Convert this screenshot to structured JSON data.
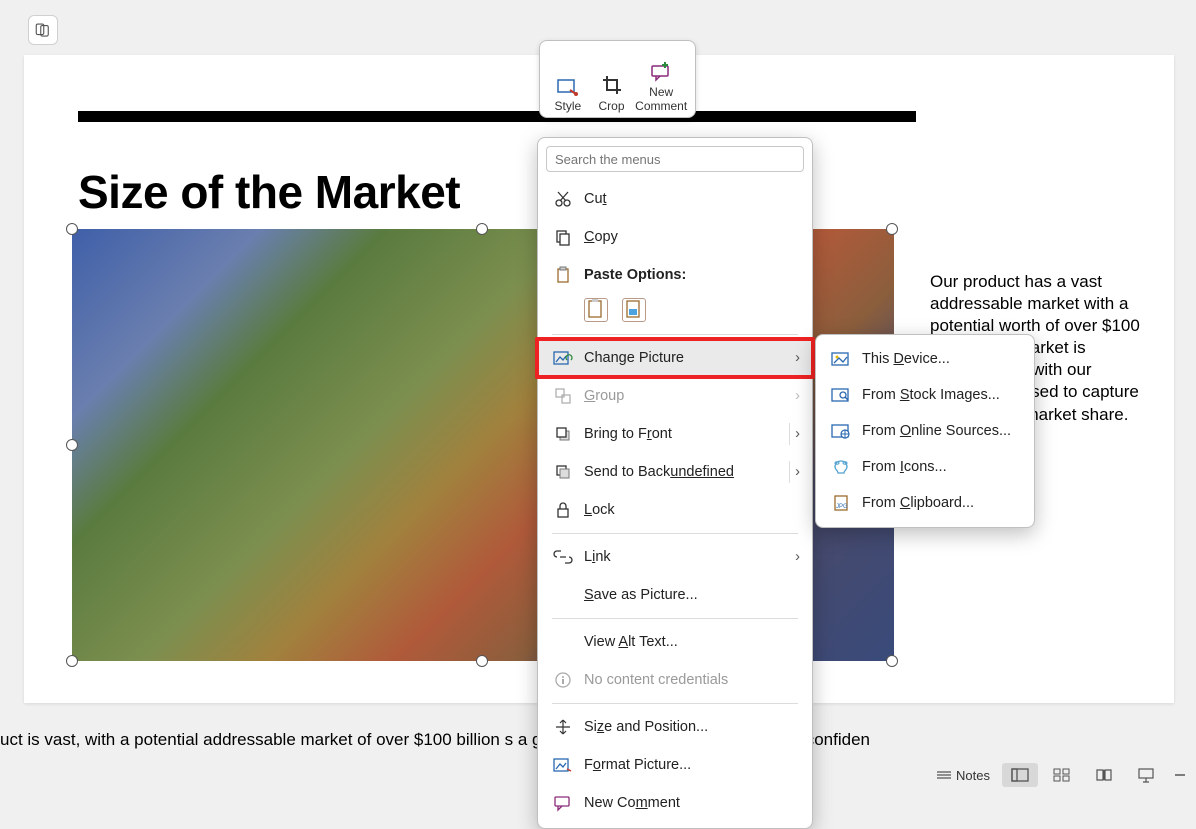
{
  "top_button": {
    "name": "copilot-icon"
  },
  "slide": {
    "title": "Size of the Market",
    "side_text": "Our product has a vast addressable market with a potential worth of over $100 billion. The market is growing, and with our product is poised to capture a significant market share.",
    "notes_snippet": "uct is vast, with a potential addressable market of over $100 billion                                                               s a growing need in the market. We are confiden"
  },
  "mini_toolbar": {
    "style": "Style",
    "crop": "Crop",
    "new_comment_l1": "New",
    "new_comment_l2": "Comment"
  },
  "context_menu": {
    "search_placeholder": "Search the menus",
    "cut": "Cut",
    "copy": "Copy",
    "paste_options": "Paste Options:",
    "change_picture": "Change Picture",
    "group": "Group",
    "bring_to_front": "Bring to Front",
    "send_to_back": "Send to Back",
    "lock": "Lock",
    "link": "Link",
    "save_as_picture": "Save as Picture...",
    "view_alt_text": "View Alt Text...",
    "no_content_credentials": "No content credentials",
    "size_and_position": "Size and Position...",
    "format_picture": "Format Picture...",
    "new_comment": "New Comment"
  },
  "submenu": {
    "this_device": "This Device...",
    "stock_images": "From Stock Images...",
    "online_sources": "From Online Sources...",
    "icons": "From Icons...",
    "clipboard": "From Clipboard..."
  },
  "status": {
    "notes": "Notes"
  }
}
